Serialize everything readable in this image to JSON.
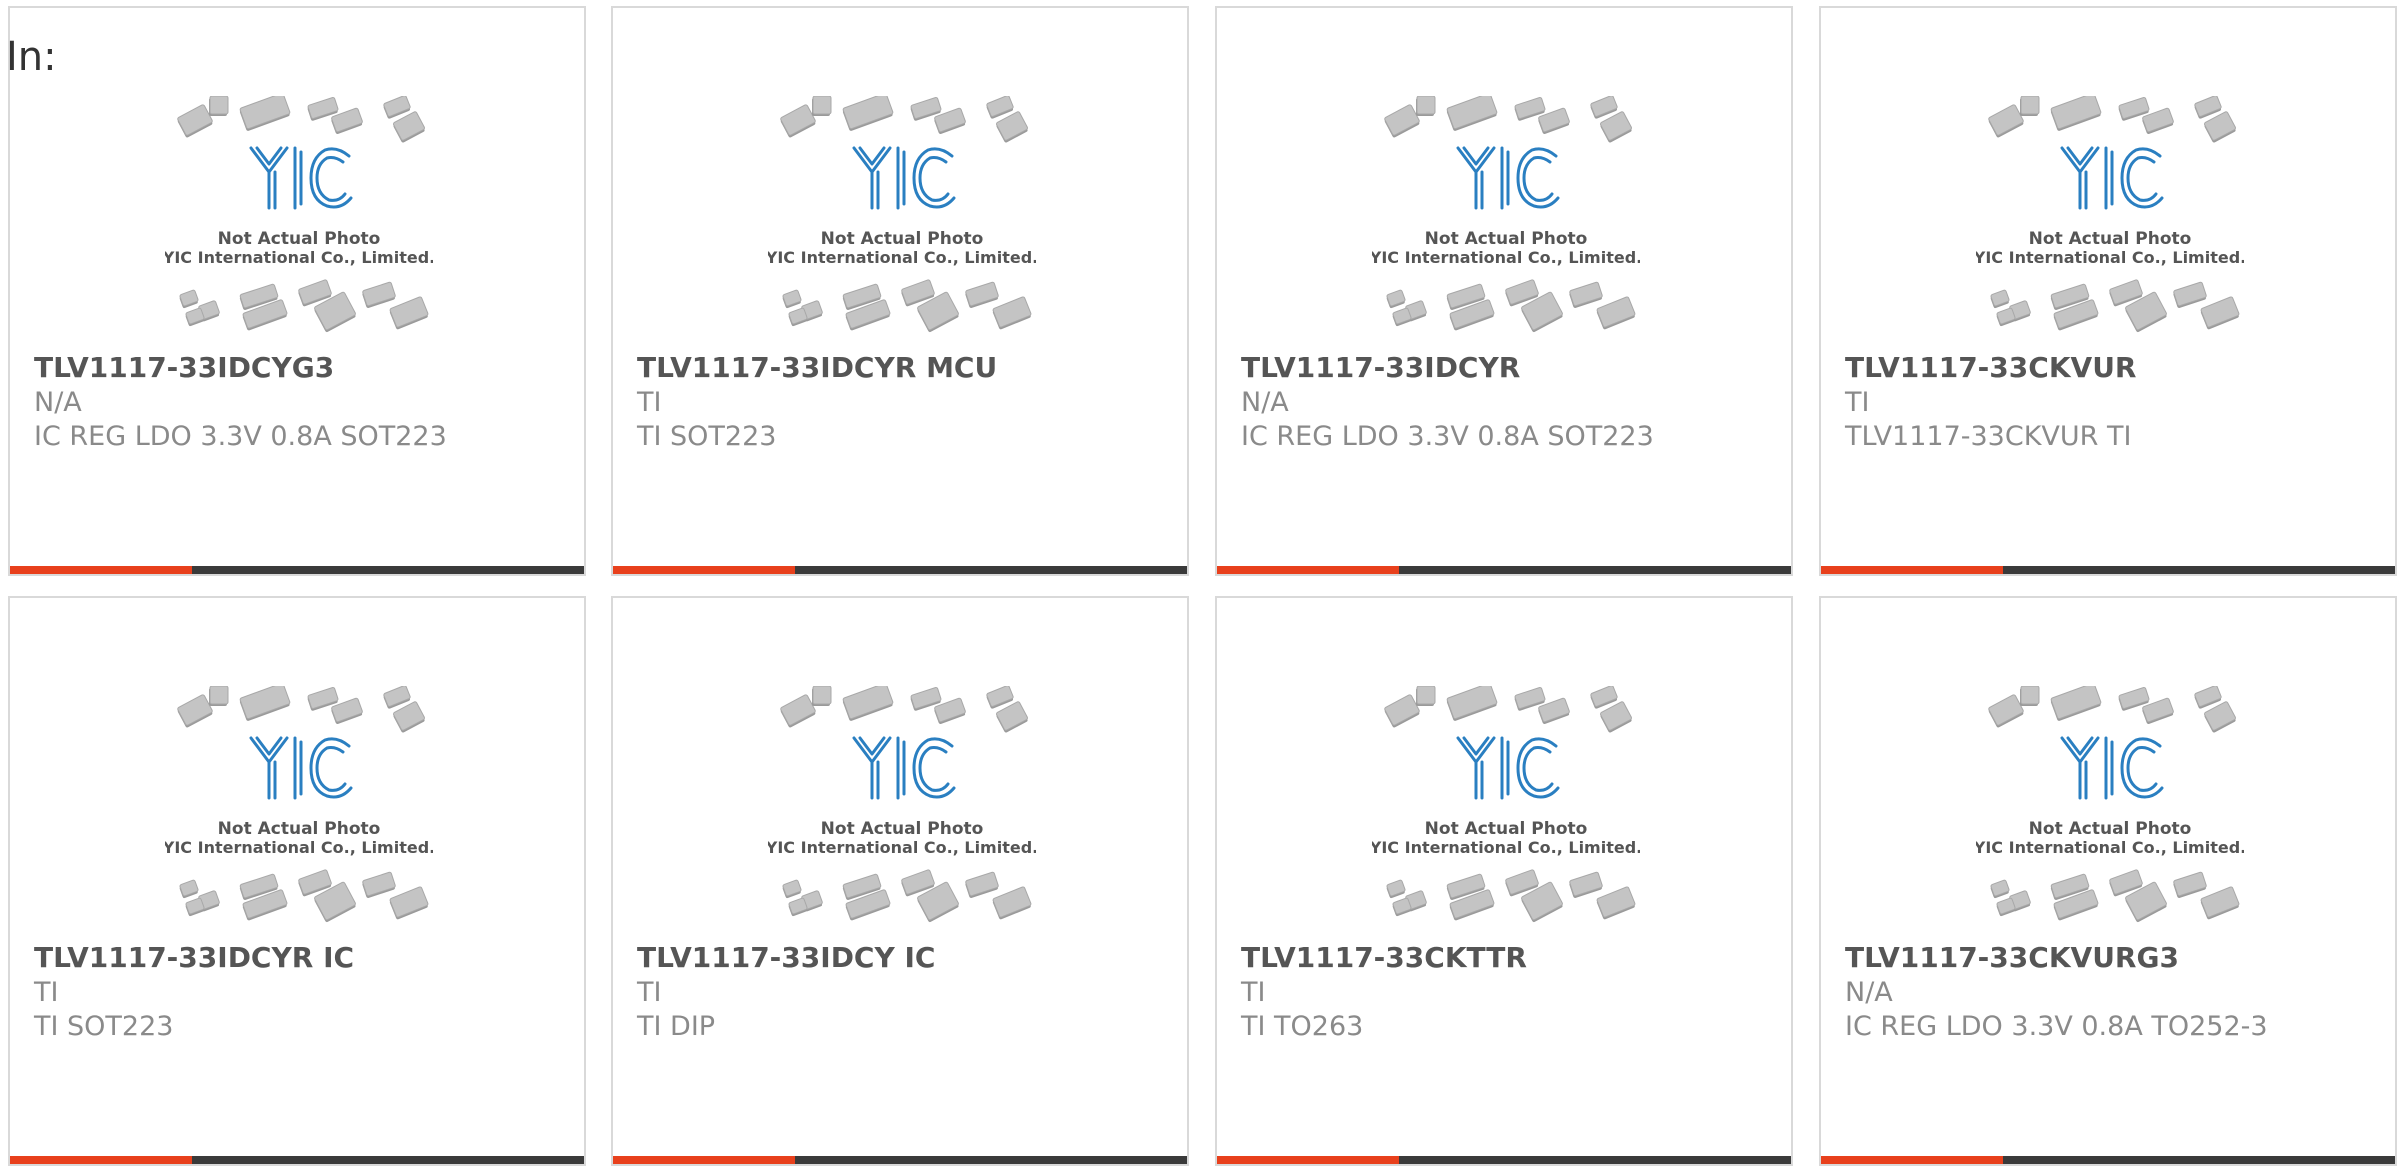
{
  "page": {
    "label": "In:"
  },
  "colors": {
    "accent": "#e8401c",
    "bar": "#3a3a3a",
    "logo": "#2a7fc1",
    "border": "#d9d9d9"
  },
  "placeholder_image": {
    "line1": "Not Actual Photo",
    "line2": "YIC International Co., Limited.",
    "logo_icon": "yic-logo-icon"
  },
  "products": [
    {
      "part_number": "TLV1117-33IDCYG3",
      "manufacturer": "N/A",
      "description": "IC REG LDO 3.3V 0.8A SOT223"
    },
    {
      "part_number": "TLV1117-33IDCYR MCU",
      "manufacturer": "TI",
      "description": "TI SOT223"
    },
    {
      "part_number": "TLV1117-33IDCYR",
      "manufacturer": "N/A",
      "description": "IC REG LDO 3.3V 0.8A SOT223"
    },
    {
      "part_number": "TLV1117-33CKVUR",
      "manufacturer": "TI",
      "description": "TLV1117-33CKVUR TI"
    },
    {
      "part_number": "TLV1117-33IDCYR IC",
      "manufacturer": "TI",
      "description": "TI SOT223"
    },
    {
      "part_number": "TLV1117-33IDCY IC",
      "manufacturer": "TI",
      "description": "TI DIP"
    },
    {
      "part_number": "TLV1117-33CKTTR",
      "manufacturer": "TI",
      "description": "TI TO263"
    },
    {
      "part_number": "TLV1117-33CKVURG3",
      "manufacturer": "N/A",
      "description": "IC REG LDO 3.3V 0.8A TO252-3"
    }
  ]
}
